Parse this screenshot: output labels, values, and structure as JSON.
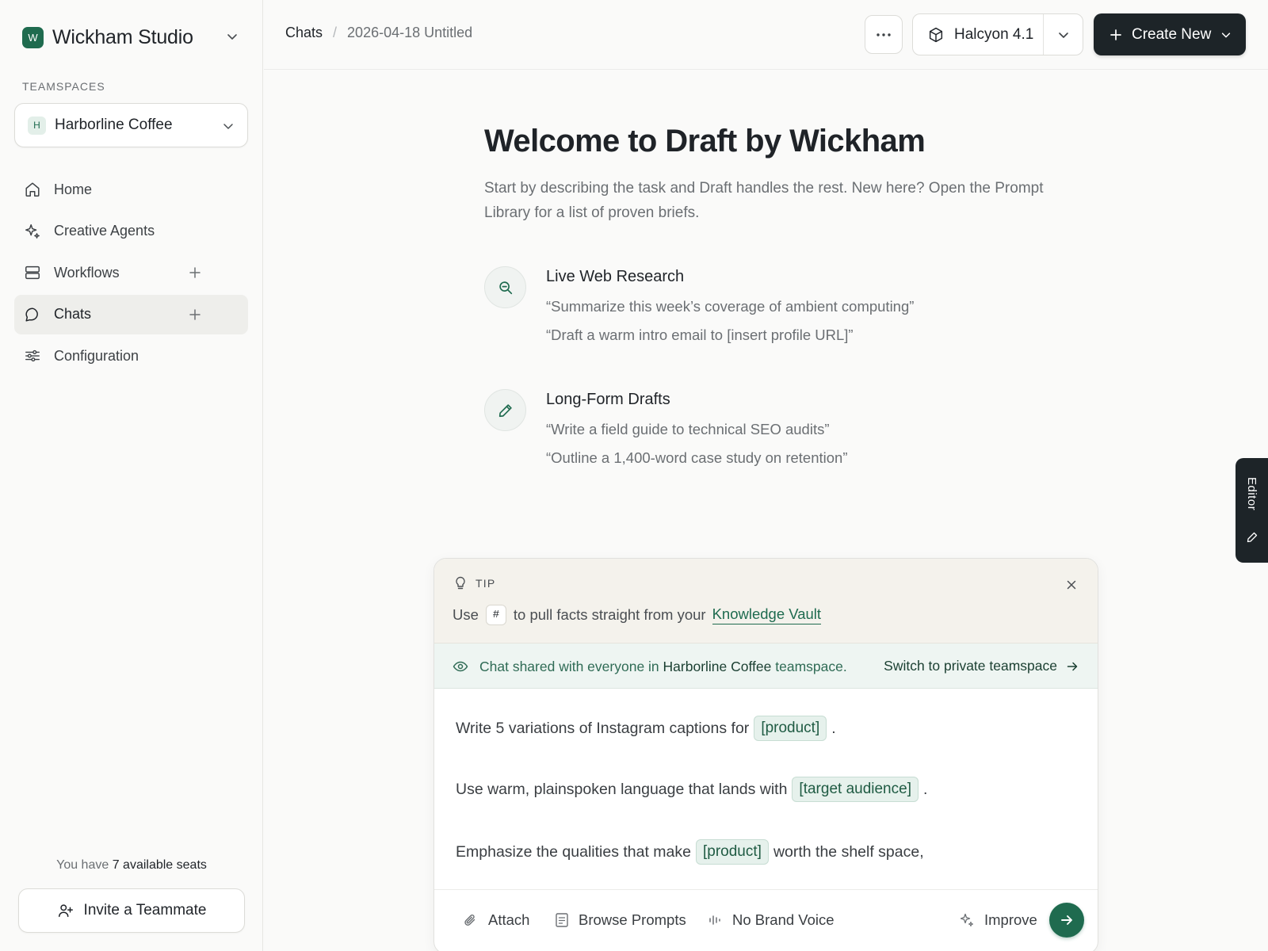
{
  "sidebar": {
    "brand": {
      "logo_letter": "W",
      "name": "Wickham Studio"
    },
    "teamspaces_label": "TEAMSPACES",
    "teamspace": {
      "badge": "H",
      "name": "Harborline Coffee"
    },
    "nav": [
      {
        "label": "Home",
        "icon": "home-icon"
      },
      {
        "label": "Creative Agents",
        "icon": "sparkle-icon"
      },
      {
        "label": "Workflows",
        "icon": "server-stack-icon",
        "has_plus": true
      },
      {
        "label": "Chats",
        "icon": "chat-bubble-icon",
        "has_plus": true,
        "active": true
      },
      {
        "label": "Configuration",
        "icon": "sliders-icon"
      }
    ],
    "seats": {
      "prefix": "You have",
      "highlight": "7 available seats"
    },
    "invite_label": "Invite a Teammate"
  },
  "header": {
    "breadcrumb": {
      "root": "Chats",
      "separator": "/",
      "current": "2026-04-18 Untitled"
    },
    "more_icon": "ellipsis-icon",
    "model": {
      "name": "Halcyon 4.1",
      "icon": "cube-icon"
    },
    "create_label": "Create New"
  },
  "welcome": {
    "title": "Welcome to Draft by Wickham",
    "subtitle": "Start by describing the task and Draft handles the rest. New here? Open the Prompt Library for a list of proven briefs.",
    "features": [
      {
        "title": "Live Web Research",
        "icon": "search-zoom-icon",
        "examples": [
          "“Summarize this week’s coverage of ambient computing”",
          "“Draft a warm intro email to [insert profile URL]”"
        ]
      },
      {
        "title": "Long-Form Drafts",
        "icon": "pencil-icon",
        "examples": [
          "“Write a field guide to technical SEO audits”",
          "“Outline a 1,400-word case study on retention”"
        ]
      }
    ]
  },
  "editor_tab": {
    "label": "Editor"
  },
  "composer": {
    "tip": {
      "label": "TIP",
      "text_before": "Use",
      "key": "#",
      "text_after": "to pull facts straight from your",
      "link": "Knowledge Vault"
    },
    "share": {
      "text_before": "Chat shared with everyone in",
      "team": "Harborline Coffee",
      "text_after": "teamspace.",
      "switch_label": "Switch to private teamspace"
    },
    "prompt": [
      {
        "before": "Write 5 variations of Instagram captions for",
        "var": "[product]",
        "after": "."
      },
      {
        "before": "Use warm, plainspoken language that lands with",
        "var": "[target audience]",
        "after": "."
      },
      {
        "before": "Emphasize the qualities that make",
        "var": "[product]",
        "after": "worth the shelf space,"
      }
    ],
    "toolbar": {
      "attach": "Attach",
      "browse": "Browse Prompts",
      "brand_voice": "No Brand Voice",
      "improve": "Improve"
    }
  },
  "colors": {
    "accent": "#1f6b4f",
    "dark": "#1d2428",
    "tip_bg": "#f4f2ec",
    "share_bg": "#eef5f2"
  }
}
